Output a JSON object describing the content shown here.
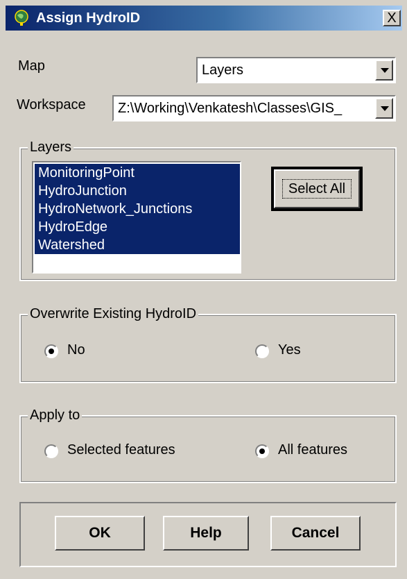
{
  "window": {
    "title": "Assign HydroID",
    "close_glyph": "X"
  },
  "map": {
    "label": "Map",
    "selected": "Layers"
  },
  "workspace": {
    "label": "Workspace",
    "selected": "Z:\\Working\\Venkatesh\\Classes\\GIS_"
  },
  "layers": {
    "group_title": "Layers",
    "items": [
      {
        "label": "MonitoringPoint",
        "selected": true
      },
      {
        "label": "HydroJunction",
        "selected": true
      },
      {
        "label": "HydroNetwork_Junctions",
        "selected": true
      },
      {
        "label": "HydroEdge",
        "selected": true
      },
      {
        "label": "Watershed",
        "selected": true
      }
    ],
    "select_all_label": "Select All"
  },
  "overwrite": {
    "group_title": "Overwrite Existing HydroID",
    "options": [
      {
        "label": "No",
        "checked": true
      },
      {
        "label": "Yes",
        "checked": false
      }
    ]
  },
  "apply_to": {
    "group_title": "Apply to",
    "options": [
      {
        "label": "Selected features",
        "checked": false
      },
      {
        "label": "All features",
        "checked": true
      }
    ]
  },
  "buttons": {
    "ok": "OK",
    "help": "Help",
    "cancel": "Cancel"
  },
  "colors": {
    "dialog_bg": "#d4d0c8",
    "title_bar": "#0a246a",
    "selection": "#0a246a"
  },
  "icons": {
    "title": "globe-icon",
    "close": "close-icon",
    "dropdown": "chevron-down-icon"
  }
}
